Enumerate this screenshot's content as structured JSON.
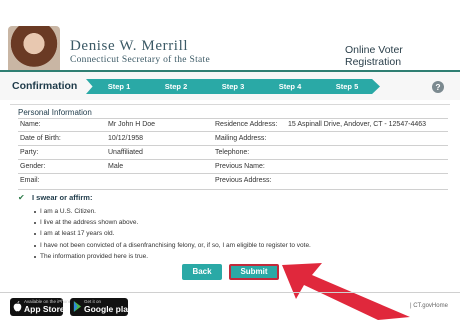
{
  "header": {
    "brand_name": "Denise W. Merrill",
    "brand_subtitle": "Connecticut Secretary of the State",
    "right_title": "Online Voter Registration"
  },
  "stepbar": {
    "title": "Confirmation",
    "steps": [
      "Step 1",
      "Step 2",
      "Step 3",
      "Step 4",
      "Step 5"
    ],
    "help_label": "?"
  },
  "personal": {
    "section_title": "Personal Information",
    "left": [
      {
        "label": "Name:",
        "value": "Mr John H Doe"
      },
      {
        "label": "Date of Birth:",
        "value": "10/12/1958"
      },
      {
        "label": "Party:",
        "value": "Unaffiliated"
      },
      {
        "label": "Gender:",
        "value": "Male"
      },
      {
        "label": "Email:",
        "value": ""
      }
    ],
    "right": [
      {
        "label": "Residence Address:",
        "value": "15 Aspinall Drive, Andover, CT - 12547-4463"
      },
      {
        "label": "Mailing Address:",
        "value": ""
      },
      {
        "label": "Telephone:",
        "value": ""
      },
      {
        "label": "Previous Name:",
        "value": ""
      },
      {
        "label": "Previous Address:",
        "value": ""
      }
    ]
  },
  "affirm": {
    "title": "I swear or affirm:",
    "items": [
      "I am a U.S. Citizen.",
      "I live at the address shown above.",
      "I am at least 17 years old.",
      "I have not been convicted of a disenfranchising felony, or, if so, I am eligible to register to vote.",
      "The information provided here is true."
    ]
  },
  "buttons": {
    "back": "Back",
    "submit": "Submit"
  },
  "footer": {
    "appstore_small": "Available on the iPhone",
    "appstore_big": "App Store",
    "googleplay_small": "Get it on",
    "googleplay_big": "Google play",
    "ct_link": "| CT.govHome"
  },
  "colors": {
    "accent": "#2aa9a6",
    "arrow": "#e0283c",
    "header_rule": "#2f7f73"
  }
}
